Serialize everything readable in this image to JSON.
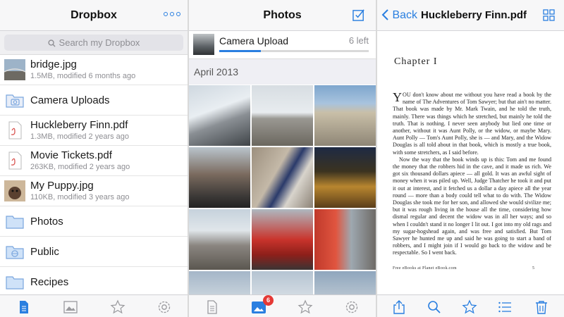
{
  "dropbox": {
    "title": "Dropbox",
    "search_placeholder": "Search my Dropbox",
    "items": [
      {
        "name": "bridge.jpg",
        "meta": "1.5MB, modified 6 months ago",
        "icon": "photo-thumbnail"
      },
      {
        "name": "Camera Uploads",
        "meta": "",
        "icon": "camera-folder-icon"
      },
      {
        "name": "Huckleberry Finn.pdf",
        "meta": "1.3MB, modified 2 years ago",
        "icon": "pdf-file-icon"
      },
      {
        "name": "Movie Tickets.pdf",
        "meta": "263KB, modified 2 years ago",
        "icon": "pdf-file-icon"
      },
      {
        "name": "My Puppy.jpg",
        "meta": "110KB, modified 3 years ago",
        "icon": "photo-thumbnail"
      },
      {
        "name": "Photos",
        "meta": "",
        "icon": "folder-icon"
      },
      {
        "name": "Public",
        "meta": "",
        "icon": "public-folder-icon"
      },
      {
        "name": "Recipes",
        "meta": "",
        "icon": "folder-icon"
      }
    ],
    "tabs": [
      "files-tab-icon",
      "photos-tab-icon",
      "favorites-tab-icon",
      "settings-tab-icon"
    ],
    "active_tab": "files"
  },
  "photos": {
    "title": "Photos",
    "upload_label": "Camera Upload",
    "upload_left": "6 left",
    "upload_progress": 0.28,
    "section": "April 2013",
    "badge": "6",
    "active_tab": "photos"
  },
  "reader": {
    "back_label": "Back",
    "title": "Huckleberry Finn.pdf",
    "chapter": "Chapter I",
    "dropcap": "Y",
    "paragraphs": [
      "OU don't know about me without you have read a book by the name of The Adventures of Tom Sawyer; but that ain't no matter. That book was made by Mr. Mark Twain, and he told the truth, mainly. There was things which he stretched, but mainly he told the truth. That is nothing. I never seen anybody but lied one time or another, without it was Aunt Polly, or the widow, or maybe Mary. Aunt Polly — Tom's Aunt Polly, she is — and Mary, and the Widow Douglas is all told about in that book, which is mostly a true book, with some stretchers, as I said before.",
      "Now the way that the book winds up is this: Tom and me found the money that the robbers hid in the cave, and it made us rich. We got six thousand dollars apiece — all gold. It was an awful sight of money when it was piled up. Well, Judge Thatcher he took it and put it out at interest, and it fetched us a dollar a day apiece all the year round — more than a body could tell what to do with. The Widow Douglas she took me for her son, and allowed she would sivilize me; but it was rough living in the house all the time, considering how dismal regular and decent the widow was in all her ways; and so when I couldn't stand it no longer I lit out. I got into my old rags and my sugar-hogshead again, and was free and satisfied. But Tom Sawyer he hunted me up and said he was going to start a band of robbers, and I might join if I would go back to the widow and be respectable. So I went back."
    ],
    "footer": "Free eBooks at Planet eBook.com",
    "page_number": "5"
  },
  "colors": {
    "accent": "#2a7fe0",
    "tabbar": "#f7f7f8",
    "badge": "#e53935"
  }
}
